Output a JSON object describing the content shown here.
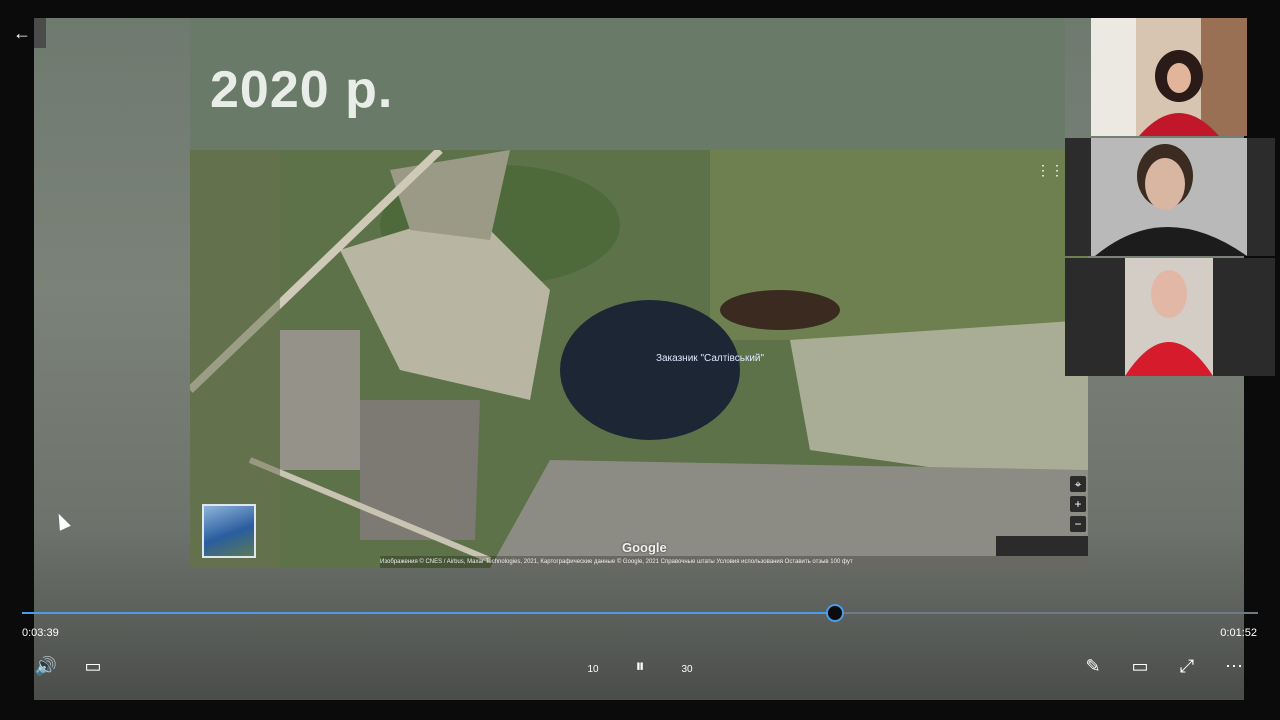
{
  "app": {
    "back_icon": "arrow-left-icon",
    "back_glyph": "←"
  },
  "slide": {
    "title": "2020 р."
  },
  "map": {
    "place_label": "Заказник \"Салтівський\"",
    "logo_text": "Google",
    "attribution": "Изображения © CNES / Airbus, Maxar Technologies, 2021, Картографические данные © Google, 2021   Справочные штаты   Условия использования   Оставить отзыв   100 фут",
    "zoom_in": "+",
    "zoom_out": "−",
    "compass": "⌖",
    "apps_glyph": "⋮⋮⋮"
  },
  "playback": {
    "current_time": "0:03:39",
    "remaining_time": "0:01:52",
    "progress_fraction": 0.658
  },
  "controls": {
    "volume_glyph": "🔊",
    "captions_glyph": "▭",
    "rewind_label": "10",
    "pause_glyph": "⏸",
    "forward_label": "30",
    "edit_glyph": "✎",
    "miniplayer_glyph": "▭",
    "fullscreen_glyph": "⤢",
    "more_glyph": "⋯"
  },
  "colors": {
    "accent": "#4a9be8",
    "background": "#0b0b0b"
  }
}
